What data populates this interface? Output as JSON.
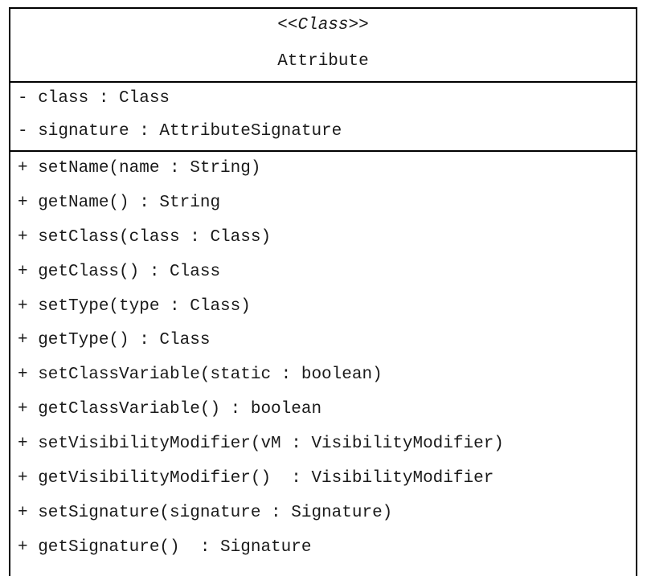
{
  "class": {
    "stereotype": "<<Class>>",
    "name": "Attribute",
    "attributes": [
      "- class : Class",
      "- signature : AttributeSignature"
    ],
    "operations": [
      "+ setName(name : String)",
      "+ getName() : String",
      "+ setClass(class : Class)",
      "+ getClass() : Class",
      "+ setType(type : Class)",
      "+ getType() : Class",
      "+ setClassVariable(static : boolean)",
      "+ getClassVariable() : boolean",
      "+ setVisibilityModifier(vM : VisibilityModifier)",
      "+ getVisibilityModifier()  : VisibilityModifier",
      "+ setSignature(signature : Signature)",
      "+ getSignature()  : Signature"
    ]
  }
}
